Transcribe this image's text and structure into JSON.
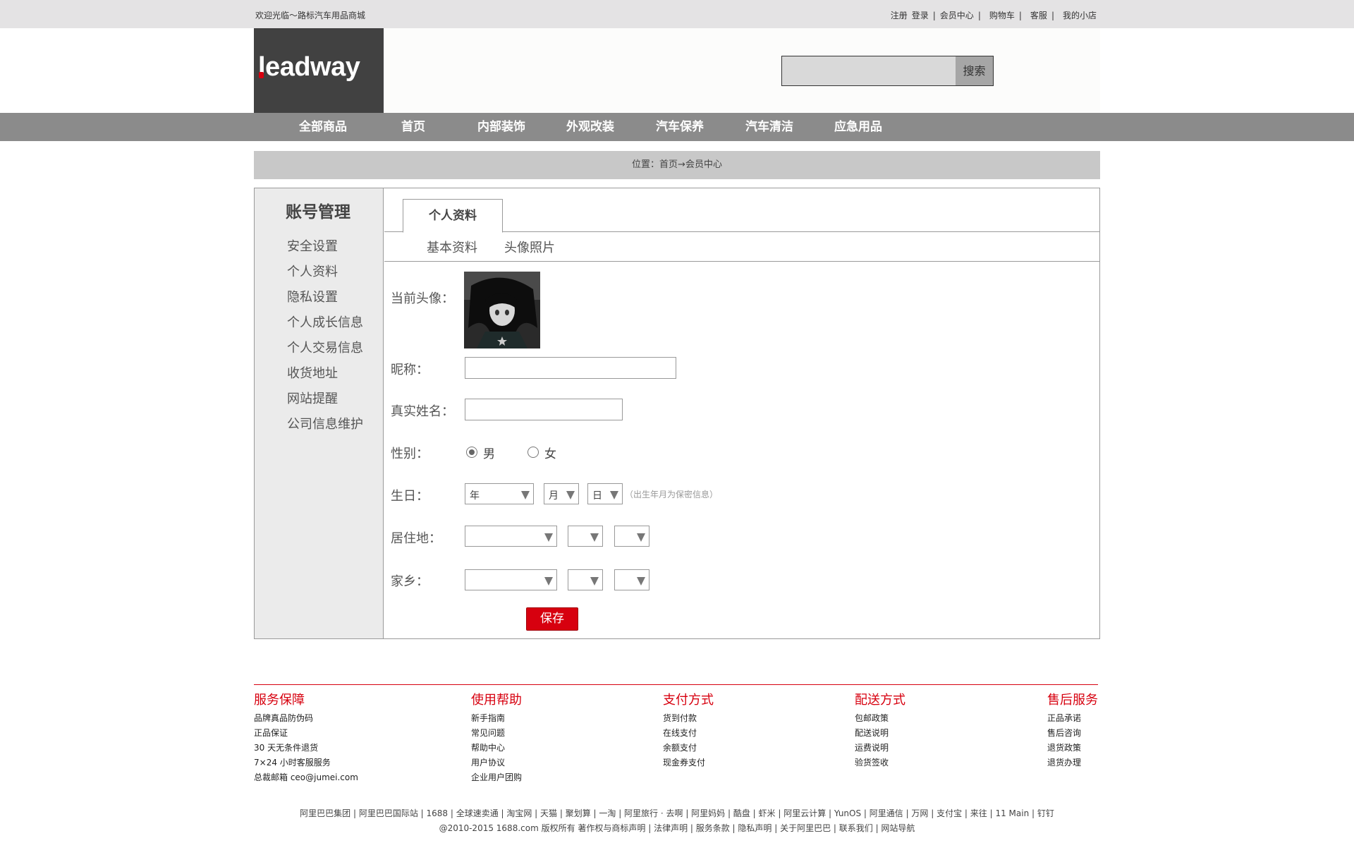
{
  "topbar": {
    "welcome": "欢迎光临～路标汽车用品商城",
    "links": [
      "注册",
      "登录",
      "会员中心",
      "购物车",
      "客服",
      "我的小店"
    ]
  },
  "logo": {
    "text": "leadway"
  },
  "search": {
    "placeholder": "",
    "button": "搜索"
  },
  "nav": [
    "全部商品",
    "首页",
    "内部装饰",
    "外观改装",
    "汽车保养",
    "汽车清洁",
    "应急用品"
  ],
  "breadcrumb": "位置：首页→会员中心",
  "sidebar": {
    "title": "账号管理",
    "items": [
      "安全设置",
      "个人资料",
      "隐私设置",
      "个人成长信息",
      "个人交易信息",
      "收货地址",
      "网站提醒",
      "公司信息维护"
    ]
  },
  "tabs": {
    "active": "个人资料",
    "subtabs": [
      "基本资料",
      "头像照片"
    ]
  },
  "form": {
    "avatar_label": "当前头像：",
    "nickname_label": "昵称：",
    "nickname_value": "",
    "realname_label": "真实姓名：",
    "realname_value": "",
    "gender_label": "性别：",
    "gender_options": [
      "男",
      "女"
    ],
    "gender_selected": "男",
    "birthday_label": "生日：",
    "birthday_year": "年",
    "birthday_month": "月",
    "birthday_day": "日",
    "birthday_hint": "（出生年月为保密信息）",
    "residence_label": "居住地：",
    "hometown_label": "家乡：",
    "save": "保存"
  },
  "footer": {
    "columns": [
      {
        "title": "服务保障",
        "links": [
          "品牌真品防伪码",
          "正品保证",
          "30 天无条件退货",
          "7×24 小时客服服务",
          "总裁邮箱 ceo@jumei.com"
        ]
      },
      {
        "title": "使用帮助",
        "links": [
          "新手指南",
          "常见问题",
          "帮助中心",
          "用户协议",
          "企业用户团购"
        ]
      },
      {
        "title": "支付方式",
        "links": [
          "货到付款",
          "在线支付",
          "余额支付",
          "现金券支付"
        ]
      },
      {
        "title": "配送方式",
        "links": [
          "包邮政策",
          "配送说明",
          "运费说明",
          "验货签收"
        ]
      },
      {
        "title": "售后服务",
        "links": [
          "正品承诺",
          "售后咨询",
          "退货政策",
          "退货办理"
        ]
      }
    ],
    "links_line": "阿里巴巴集团 | 阿里巴巴国际站 | 1688 | 全球速卖通 | 淘宝网 | 天猫 | 聚划算 | 一淘 | 阿里旅行 · 去啊 | 阿里妈妈 | 酷盘 | 虾米 | 阿里云计算 | YunOS | 阿里通信 | 万网 | 支付宝 | 来往 | 11 Main | 钉钉",
    "copyright": "@2010-2015 1688.com 版权所有 著作权与商标声明 | 法律声明 | 服务条款 | 隐私声明 | 关于阿里巴巴 | 联系我们 | 网站导航"
  },
  "colors": {
    "accent": "#d7000f",
    "nav_bg": "#8b8b8b",
    "topbar_bg": "#e4e3e4",
    "logo_bg": "#414141"
  }
}
